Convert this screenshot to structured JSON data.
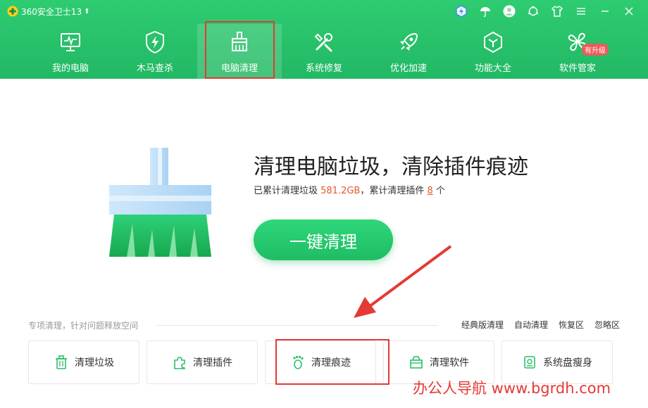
{
  "app": {
    "title": "360安全卫士13"
  },
  "nav": [
    {
      "label": "我的电脑",
      "icon": "monitor-icon"
    },
    {
      "label": "木马查杀",
      "icon": "shield-bolt-icon"
    },
    {
      "label": "电脑清理",
      "icon": "broom-icon",
      "active": true
    },
    {
      "label": "系统修复",
      "icon": "tools-icon"
    },
    {
      "label": "优化加速",
      "icon": "rocket-icon"
    },
    {
      "label": "功能大全",
      "icon": "cube-icon"
    },
    {
      "label": "软件管家",
      "icon": "clover-icon"
    }
  ],
  "nav_badge": "有升级",
  "main": {
    "headline": "清理电脑垃圾，清除插件痕迹",
    "stats_prefix": "已累计清理垃圾 ",
    "stats_junk": "581.2GB",
    "stats_mid": "，累计清理插件 ",
    "stats_plugins": "8",
    "stats_suffix": " 个",
    "cta": "一键清理"
  },
  "special": {
    "label": "专项清理，针对问题释放空间",
    "links": [
      "经典版清理",
      "自动清理",
      "恢复区",
      "忽略区"
    ],
    "cards": [
      {
        "label": "清理垃圾",
        "icon": "trash-icon"
      },
      {
        "label": "清理插件",
        "icon": "puzzle-icon"
      },
      {
        "label": "清理痕迹",
        "icon": "footprint-icon"
      },
      {
        "label": "清理软件",
        "icon": "package-icon"
      },
      {
        "label": "系统盘瘦身",
        "icon": "disk-icon"
      }
    ]
  },
  "watermark": "办公人导航 www.bgrdh.com",
  "colors": {
    "header": "#22b864",
    "accent": "#e8552b",
    "annotation": "#e53935"
  }
}
